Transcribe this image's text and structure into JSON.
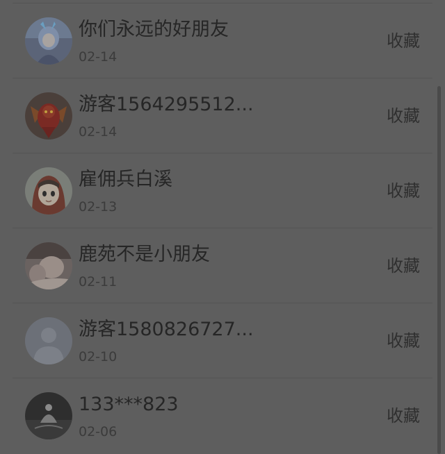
{
  "list": {
    "items": [
      {
        "name": "你们永远的好朋友",
        "date": "02-14",
        "action": "收藏",
        "avatar_icon": "anime-girl-avatar"
      },
      {
        "name": "游客1564295512...",
        "date": "02-14",
        "action": "收藏",
        "avatar_icon": "red-armor-avatar"
      },
      {
        "name": "雇佣兵白溪",
        "date": "02-13",
        "action": "收藏",
        "avatar_icon": "hooded-girl-avatar"
      },
      {
        "name": "鹿苑不是小朋友",
        "date": "02-11",
        "action": "收藏",
        "avatar_icon": "photo-avatar"
      },
      {
        "name": "游客1580826727...",
        "date": "02-10",
        "action": "收藏",
        "avatar_icon": "default-user-avatar"
      },
      {
        "name": "133***823",
        "date": "02-06",
        "action": "收藏",
        "avatar_icon": "dark-photo-avatar"
      }
    ]
  }
}
